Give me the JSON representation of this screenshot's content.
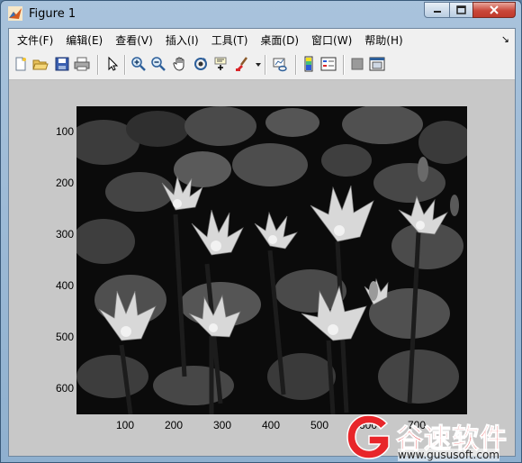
{
  "window": {
    "title": "Figure 1"
  },
  "menu": {
    "items": [
      {
        "label": "文件(F)"
      },
      {
        "label": "编辑(E)"
      },
      {
        "label": "查看(V)"
      },
      {
        "label": "插入(I)"
      },
      {
        "label": "工具(T)"
      },
      {
        "label": "桌面(D)"
      },
      {
        "label": "窗口(W)"
      },
      {
        "label": "帮助(H)"
      }
    ],
    "overflow": "↘"
  },
  "toolbar": {
    "buttons": [
      "new-figure-icon",
      "open-file-icon",
      "save-icon",
      "print-icon",
      "edit-plot-arrow-icon",
      "zoom-in-icon",
      "zoom-out-icon",
      "pan-hand-icon",
      "rotate-3d-icon",
      "data-cursor-icon",
      "brush-icon",
      "link-plot-icon",
      "colorbar-icon",
      "legend-icon",
      "hide-plot-tools-icon",
      "show-plot-tools-icon"
    ]
  },
  "axes": {
    "y_ticks": [
      "100",
      "200",
      "300",
      "400",
      "500",
      "600"
    ],
    "x_ticks": [
      "100",
      "200",
      "300",
      "400",
      "500",
      "600",
      "700"
    ],
    "image": "grayscale-water-lilies"
  },
  "watermark": {
    "brand": "谷速软件",
    "url": "www.gususoft.com",
    "colors": {
      "brand": "#e8262a"
    }
  }
}
